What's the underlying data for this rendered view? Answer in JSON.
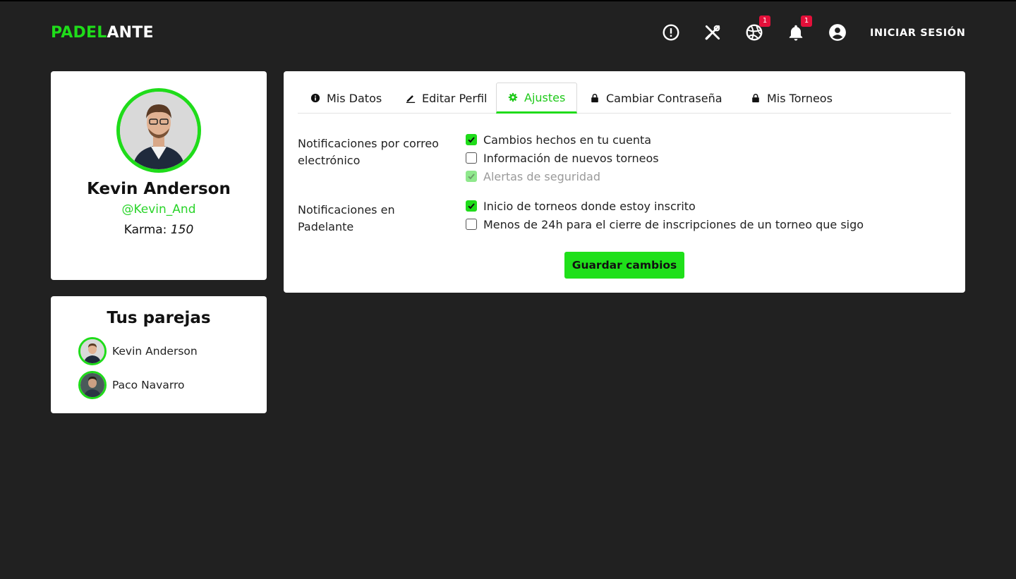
{
  "header": {
    "logo_part1": "PADEL",
    "logo_part2": "ANTE",
    "login_label": "INICIAR SESIÓN",
    "icons": [
      {
        "name": "alert-icon",
        "badge": ""
      },
      {
        "name": "tools-icon",
        "badge": ""
      },
      {
        "name": "ball-icon",
        "badge": "1"
      },
      {
        "name": "bell-icon",
        "badge": "1"
      },
      {
        "name": "account-icon",
        "badge": ""
      }
    ]
  },
  "colors": {
    "brand_green": "#1fdc1a",
    "background": "#212121",
    "badge_red": "#e4103a"
  },
  "profile": {
    "name": "Kevin Anderson",
    "handle": "@Kevin_And",
    "karma_label": "Karma:",
    "karma_value": "150"
  },
  "partners": {
    "title": "Tus parejas",
    "items": [
      {
        "name": "Kevin Anderson"
      },
      {
        "name": "Paco Navarro"
      }
    ]
  },
  "tabs": [
    {
      "label": "Mis Datos",
      "icon": "info-icon"
    },
    {
      "label": "Editar Perfil",
      "icon": "pencil-icon"
    },
    {
      "label": "Ajustes",
      "icon": "gear-icon",
      "active": true
    },
    {
      "label": "Cambiar Contraseña",
      "icon": "lock-icon"
    },
    {
      "label": "Mis Torneos",
      "icon": "lock-icon"
    }
  ],
  "email_group": {
    "label": "Notificaciones por correo electrónico",
    "options": [
      {
        "label": "Cambios hechos en tu cuenta",
        "checked": true,
        "disabled": false
      },
      {
        "label": "Información de nuevos torneos",
        "checked": false,
        "disabled": false
      },
      {
        "label": "Alertas de seguridad",
        "checked": true,
        "disabled": true
      }
    ]
  },
  "app_group": {
    "label": "Notificaciones en Padelante",
    "options": [
      {
        "label": "Inicio de torneos donde estoy inscrito",
        "checked": true,
        "disabled": false
      },
      {
        "label": "Menos de 24h para el cierre de inscripciones de un torneo que sigo",
        "checked": false,
        "disabled": false
      }
    ]
  },
  "save_label": "Guardar cambios"
}
